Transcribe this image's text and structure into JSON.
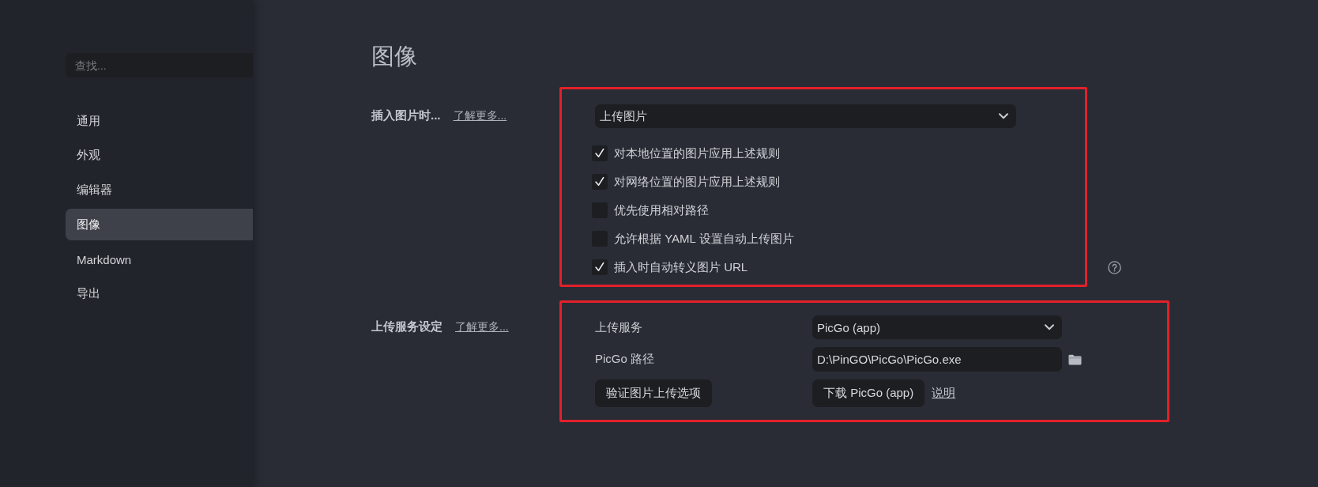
{
  "sidebar": {
    "search": {
      "placeholder": "查找..."
    },
    "items": [
      {
        "label": "通用",
        "selected": false
      },
      {
        "label": "外观",
        "selected": false
      },
      {
        "label": "编辑器",
        "selected": false
      },
      {
        "label": "图像",
        "selected": true
      },
      {
        "label": "Markdown",
        "selected": false
      },
      {
        "label": "导出",
        "selected": false
      }
    ]
  },
  "page": {
    "title": "图像"
  },
  "sections": [
    {
      "kind": "rules",
      "label": "插入图片时...",
      "link": "了解更多...",
      "highlighted": true,
      "dropdown": {
        "value": "上传图片"
      },
      "options": [
        {
          "label": "对本地位置的图片应用上述规则",
          "checked": true
        },
        {
          "label": "对网络位置的图片应用上述规则",
          "checked": true
        },
        {
          "label": "优先使用相对路径",
          "checked": false
        },
        {
          "label": "允许根据 YAML 设置自动上传图片",
          "checked": false
        },
        {
          "label": "插入时自动转义图片 URL",
          "checked": true
        }
      ]
    },
    {
      "kind": "service",
      "label": "上传服务设定",
      "link": "了解更多...",
      "highlighted": true,
      "rows": [
        {
          "kind": "select",
          "label": "上传服务",
          "value": "PicGo (app)"
        },
        {
          "kind": "path",
          "label": "PicGo 路径",
          "value": "D:\\PinGO\\PicGo\\PicGo.exe"
        },
        {
          "kind": "actions",
          "button": "验证图片上传选项",
          "download_button": "下载 PicGo (app)",
          "link": "说明"
        }
      ]
    }
  ]
}
